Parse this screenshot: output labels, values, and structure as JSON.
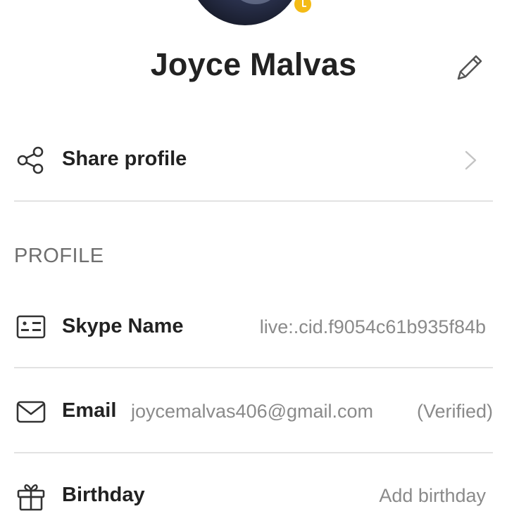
{
  "profile": {
    "name": "Joyce Malvas",
    "presence_color": "#f4bb16"
  },
  "share": {
    "label": "Share profile"
  },
  "section": {
    "title": "PROFILE"
  },
  "fields": {
    "skype_name": {
      "label": "Skype Name",
      "value": "live:.cid.f9054c61b935f84b"
    },
    "email": {
      "label": "Email",
      "value": "joycemalvas406@gmail.com",
      "status": "(Verified)"
    },
    "birthday": {
      "label": "Birthday",
      "value": "Add birthday"
    }
  },
  "icons": {
    "edit": "pencil-icon",
    "share": "share-icon",
    "chevron": "chevron-right-icon",
    "skype_name": "id-card-icon",
    "email": "envelope-icon",
    "birthday": "gift-icon"
  }
}
